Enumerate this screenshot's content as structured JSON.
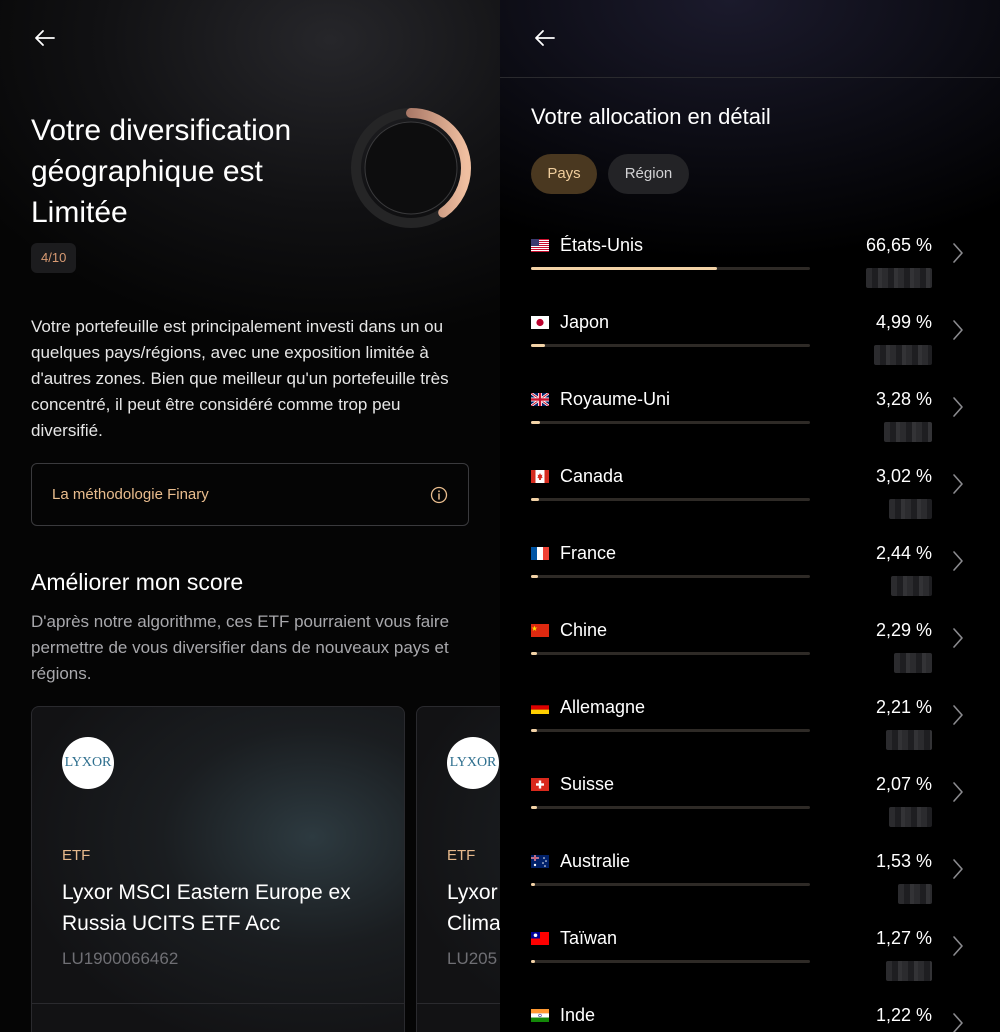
{
  "left": {
    "headline": "Votre diversification géographique est Limitée",
    "score_badge": "4/10",
    "score_value": 4,
    "score_max": 10,
    "description": "Votre portefeuille est principalement investi dans un ou quelques pays/régions, avec une exposition limitée à d'autres zones. Bien que meilleur qu'un portefeuille très concentré, il peut être considéré comme trop peu diversifié.",
    "methodology_label": "La méthodologie Finary",
    "improve_title": "Améliorer mon score",
    "improve_description": "D'après notre algorithme, ces ETF pourraient vous faire permettre de vous diversifier dans de nouveaux pays et régions.",
    "cards": [
      {
        "logo_text": "LYXOR",
        "type": "ETF",
        "name": "Lyxor MSCI Eastern Europe ex\nRussia UCITS ETF Acc",
        "isin": "LU1900066462"
      },
      {
        "logo_text": "LYXOR",
        "type": "ETF",
        "name": "Lyxor\nClima",
        "isin": "LU205"
      }
    ]
  },
  "right": {
    "title": "Votre allocation en détail",
    "tabs": [
      {
        "label": "Pays",
        "active": true
      },
      {
        "label": "Région",
        "active": false
      }
    ],
    "countries": [
      {
        "name": "États-Unis",
        "percent_label": "66,65 %",
        "percent": 66.65,
        "flag": "us-flag-icon"
      },
      {
        "name": "Japon",
        "percent_label": "4,99 %",
        "percent": 4.99,
        "flag": "jp-flag-icon"
      },
      {
        "name": "Royaume-Uni",
        "percent_label": "3,28 %",
        "percent": 3.28,
        "flag": "gb-flag-icon"
      },
      {
        "name": "Canada",
        "percent_label": "3,02 %",
        "percent": 3.02,
        "flag": "ca-flag-icon"
      },
      {
        "name": "France",
        "percent_label": "2,44 %",
        "percent": 2.44,
        "flag": "fr-flag-icon"
      },
      {
        "name": "Chine",
        "percent_label": "2,29 %",
        "percent": 2.29,
        "flag": "cn-flag-icon"
      },
      {
        "name": "Allemagne",
        "percent_label": "2,21 %",
        "percent": 2.21,
        "flag": "de-flag-icon"
      },
      {
        "name": "Suisse",
        "percent_label": "2,07 %",
        "percent": 2.07,
        "flag": "ch-flag-icon"
      },
      {
        "name": "Australie",
        "percent_label": "1,53 %",
        "percent": 1.53,
        "flag": "au-flag-icon"
      },
      {
        "name": "Taïwan",
        "percent_label": "1,27 %",
        "percent": 1.27,
        "flag": "tw-flag-icon"
      },
      {
        "name": "Inde",
        "percent_label": "1,22 %",
        "percent": 1.22,
        "flag": "in-flag-icon"
      }
    ]
  },
  "colors": {
    "accent": "#e9bd8e",
    "bar_fill": "#f2d2a6",
    "ring_start": "#e8b292",
    "ring_end": "#7a4a40"
  }
}
